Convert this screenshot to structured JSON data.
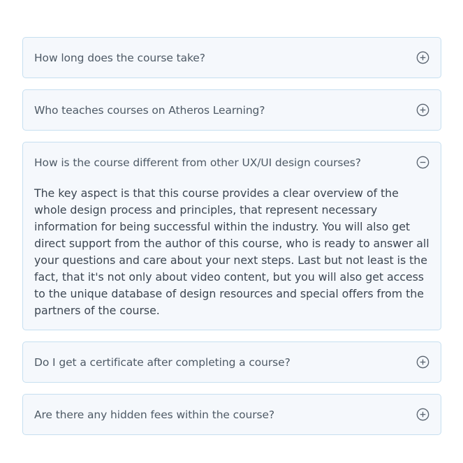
{
  "faq": {
    "items": [
      {
        "question": "How long does the course take?",
        "expanded": false,
        "icon": "plus-circle-icon"
      },
      {
        "question": "Who teaches courses on Atheros Learning?",
        "expanded": false,
        "icon": "plus-circle-icon"
      },
      {
        "question": "How is the course different from other UX/UI design courses?",
        "expanded": true,
        "icon": "minus-circle-icon",
        "answer": "The key aspect is that this course provides a clear overview of the whole design process and principles, that represent necessary information for being successful within the industry. You will also get direct support from the author of this course, who is ready to answer all your questions and care about your next steps. Last but not least is the fact, that it's not only about video content, but you will also get access to the unique database of design resources and special offers from the partners of the course."
      },
      {
        "question": "Do I get a certificate after completing a course?",
        "expanded": false,
        "icon": "plus-circle-icon"
      },
      {
        "question": "Are there any hidden fees within the course?",
        "expanded": false,
        "icon": "plus-circle-icon"
      }
    ]
  },
  "colors": {
    "card_background": "#f5f8fc",
    "card_border": "#c6dff0",
    "question_text": "#4e5a66",
    "answer_text": "#3c4652",
    "icon": "#5a6470"
  }
}
